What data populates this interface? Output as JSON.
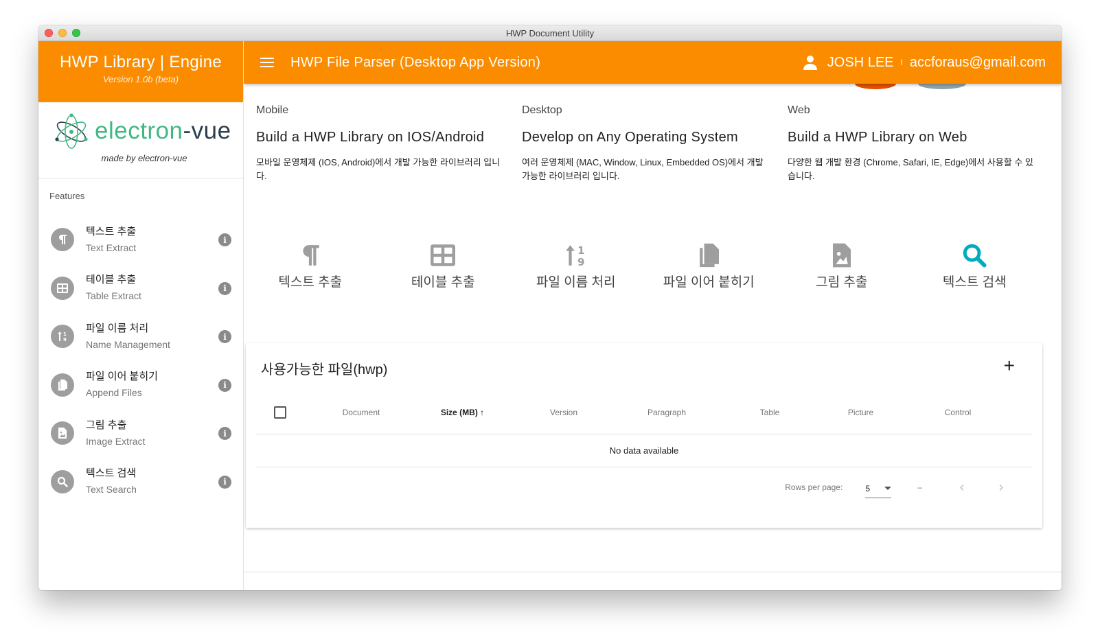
{
  "window": {
    "title": "HWP Document Utility"
  },
  "brand": {
    "title": "HWP Library | Engine",
    "version": "Version 1.0b (beta)"
  },
  "electron_vue": {
    "name_part1": "electron",
    "name_part2": "-vue",
    "made_by": "made by electron-vue"
  },
  "sidebar": {
    "heading": "Features",
    "items": [
      {
        "title": "텍스트 추출",
        "subtitle": "Text Extract",
        "icon": "pilcrow-icon"
      },
      {
        "title": "테이블 추출",
        "subtitle": "Table Extract",
        "icon": "table-icon"
      },
      {
        "title": "파일 이름 처리",
        "subtitle": "Name Management",
        "icon": "sort-numeric-icon"
      },
      {
        "title": "파일 이어 붙히기",
        "subtitle": "Append Files",
        "icon": "copy-files-icon"
      },
      {
        "title": "그림 추출",
        "subtitle": "Image Extract",
        "icon": "image-file-icon"
      },
      {
        "title": "텍스트 검색",
        "subtitle": "Text Search",
        "icon": "search-icon"
      }
    ]
  },
  "appbar": {
    "title": "HWP File Parser (Desktop App Version)",
    "user_name": "JOSH LEE",
    "separator": "I",
    "email": "accforaus@gmail.com"
  },
  "platforms": [
    {
      "label": "Mobile",
      "title": "Build a HWP Library on IOS/Android",
      "desc": "모바일 운영체제 (IOS, Android)에서 개발 가능한 라이브러리 입니다."
    },
    {
      "label": "Desktop",
      "title": "Develop on Any Operating System",
      "desc": "여러 운영체제 (MAC, Window, Linux, Embedded OS)에서 개발 가능한 라이브러리 입니다."
    },
    {
      "label": "Web",
      "title": "Build a HWP Library on Web",
      "desc": "다양한 웹 개발 환경 (Chrome, Safari, IE, Edge)에서 사용할 수 있습니다."
    }
  ],
  "actions": [
    {
      "label": "텍스트 추출",
      "icon": "pilcrow-icon"
    },
    {
      "label": "테이블 추출",
      "icon": "table-icon"
    },
    {
      "label": "파일 이름 처리",
      "icon": "sort-numeric-icon"
    },
    {
      "label": "파일 이어 붙히기",
      "icon": "copy-files-icon"
    },
    {
      "label": "그림 추출",
      "icon": "image-file-icon"
    },
    {
      "label": "텍스트 검색",
      "icon": "search-icon",
      "active": true
    }
  ],
  "files_card": {
    "title": "사용가능한 파일(hwp)",
    "add_label": "+",
    "columns": [
      "Document",
      "Size (MB)",
      "Version",
      "Paragraph",
      "Table",
      "Picture",
      "Control"
    ],
    "sort_arrow": "↑",
    "empty_text": "No data available",
    "rows_per_page_label": "Rows per page:",
    "rows_per_page_value": "5",
    "page_range": "–",
    "prev": "‹",
    "next": "›"
  },
  "colors": {
    "accent": "#fb8c00",
    "active_icon": "#00acc1",
    "icon_gray": "#9e9e9e",
    "vue_green": "#41b883",
    "vue_dark": "#2c3e50"
  }
}
